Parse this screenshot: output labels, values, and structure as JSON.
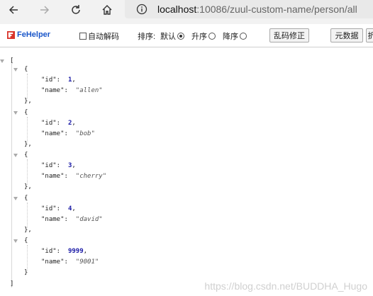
{
  "browser": {
    "url_host": "localhost",
    "url_rest": ":10086/zuul-custom-name/person/all"
  },
  "toolbar": {
    "logo": "FeHelper",
    "auto_decode": "自动解码",
    "sort_label": "排序:",
    "sort_default": "默认",
    "sort_asc": "升序",
    "sort_desc": "降序",
    "fix_garbled": "乱码修正",
    "meta_data": "元数据",
    "cut_button": "折"
  },
  "json": {
    "open_bracket": "[",
    "close_bracket": "]",
    "open_brace": "{",
    "close_brace": "},",
    "last_close_brace": "}",
    "key_id": "\"id\":",
    "key_name": "\"name\":",
    "items": [
      {
        "id": "1",
        "name": "\"allen\""
      },
      {
        "id": "2",
        "name": "\"bob\""
      },
      {
        "id": "3",
        "name": "\"cherry\""
      },
      {
        "id": "4",
        "name": "\"david\""
      },
      {
        "id": "9999",
        "name": "\"9001\""
      }
    ]
  },
  "watermark": "https://blog.csdn.net/BUDDHA_Hugo"
}
